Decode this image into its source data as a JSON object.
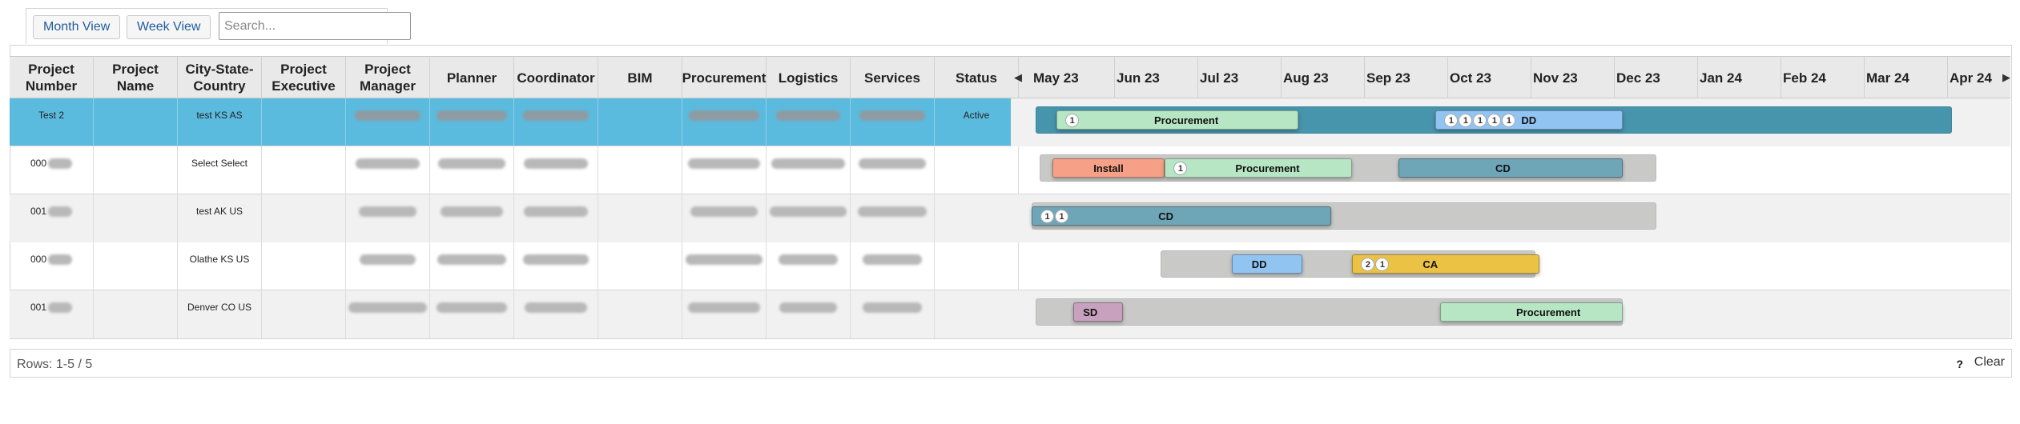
{
  "toolbar": {
    "month_view_label": "Month View",
    "week_view_label": "Week View",
    "search_placeholder": "Search..."
  },
  "columns": [
    "Project Number",
    "Project Name",
    "City-State-Country",
    "Project Executive",
    "Project Manager",
    "Planner",
    "Coordinator",
    "BIM",
    "Procurement",
    "Logistics",
    "Services",
    "Status"
  ],
  "timeline": {
    "prev_icon": "caret-left-icon",
    "next_icon": "caret-right-icon",
    "months": [
      "May 23",
      "Jun 23",
      "Jul 23",
      "Aug 23",
      "Sep 23",
      "Oct 23",
      "Nov 23",
      "Dec 23",
      "Jan 24",
      "Feb 24",
      "Mar 24",
      "Apr 24"
    ]
  },
  "colors": {
    "selected_row": "#5bbbdf",
    "procurement": "#b7e6c4",
    "install": "#f5a087",
    "cd": "#6ea6b8",
    "dd": "#92c4f2",
    "ca": "#ecc244",
    "sd": "#c7a1bd"
  },
  "rows": [
    {
      "project_number": "Test 2",
      "project_name": "",
      "city": "test KS AS",
      "executive": "",
      "status": "Active",
      "track": [
        0.05,
        11.05
      ],
      "bars": [
        {
          "label": "Procurement",
          "start": 0.3,
          "end": 3.2,
          "color": "#b7e6c4",
          "badges": [
            "1"
          ]
        },
        {
          "label": "DD",
          "start": 4.85,
          "end": 7.1,
          "color": "#92c4f2",
          "badges": [
            "1",
            "1",
            "1",
            "1",
            "1"
          ]
        }
      ]
    },
    {
      "project_number": "000",
      "project_name": "",
      "city": "Select Select",
      "executive": "",
      "status": "",
      "track": [
        0.1,
        7.5
      ],
      "bars": [
        {
          "label": "Install",
          "start": 0.25,
          "end": 1.6,
          "color": "#f5a087",
          "badges": []
        },
        {
          "label": "Procurement",
          "start": 1.6,
          "end": 3.85,
          "color": "#b7e6c4",
          "badges": [
            "1"
          ]
        },
        {
          "label": "CD",
          "start": 4.4,
          "end": 7.1,
          "color": "#6ea6b8",
          "badges": []
        }
      ]
    },
    {
      "project_number": "001",
      "project_name": "",
      "city": "test AK US",
      "executive": "",
      "status": "",
      "track": [
        0.0,
        7.5
      ],
      "bars": [
        {
          "label": "CD",
          "start": 0.0,
          "end": 3.6,
          "color": "#6ea6b8",
          "badges": [
            "1",
            "1"
          ]
        }
      ]
    },
    {
      "project_number": "000",
      "project_name": "",
      "city": "Olathe KS US",
      "executive": "",
      "status": "",
      "track": [
        1.55,
        6.05
      ],
      "bars": [
        {
          "label": "DD",
          "start": 2.4,
          "end": 3.25,
          "color": "#92c4f2",
          "badges": []
        },
        {
          "label": "CA",
          "start": 3.85,
          "end": 6.1,
          "color": "#ecc244",
          "badges": [
            "2",
            "1"
          ]
        }
      ]
    },
    {
      "project_number": "001",
      "project_name": "",
      "city": "Denver CO US",
      "executive": "",
      "status": "",
      "track": [
        0.05,
        7.1
      ],
      "bars": [
        {
          "label": "SD",
          "start": 0.5,
          "end": 1.1,
          "color": "#c7a1bd",
          "badges": []
        },
        {
          "label": "Procurement",
          "start": 4.9,
          "end": 7.1,
          "color": "#b7e6c4",
          "badges": []
        }
      ]
    }
  ],
  "footer": {
    "rows_info": "Rows: 1-5 / 5",
    "help": "?",
    "clear": "Clear"
  }
}
